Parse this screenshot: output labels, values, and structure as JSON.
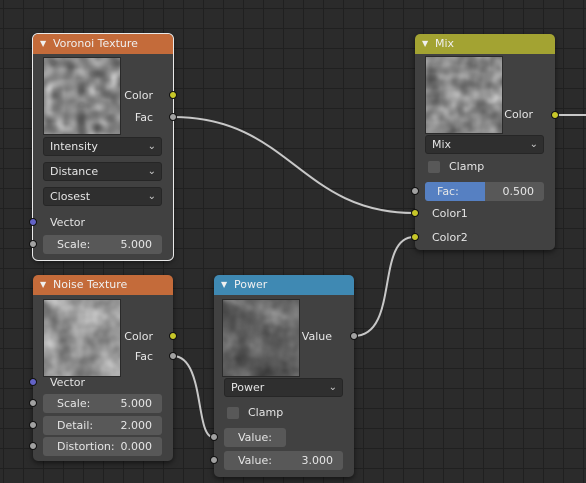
{
  "colors": {
    "texture_header": "#c46b3a",
    "converter_header": "#3f89b3",
    "color_header": "#a3a332",
    "socket_color": "#c7c729",
    "socket_value": "#a1a1a1",
    "socket_vector": "#6363c7",
    "slider_fill": "#5680c2",
    "link": "#c8c8c8"
  },
  "voronoi_node": {
    "title": "Voronoi Texture",
    "outputs": [
      "Color",
      "Fac"
    ],
    "coloring": "Intensity",
    "distance": "Distance",
    "feature": "Closest",
    "vector_label": "Vector",
    "scale_label": "Scale:",
    "scale_value": "5.000"
  },
  "noise_node": {
    "title": "Noise Texture",
    "outputs": [
      "Color",
      "Fac"
    ],
    "vector_label": "Vector",
    "scale_label": "Scale:",
    "scale_value": "5.000",
    "detail_label": "Detail:",
    "detail_value": "2.000",
    "distortion_label": "Distortion:",
    "distortion_value": "0.000"
  },
  "power_node": {
    "title": "Power",
    "output": "Value",
    "operation": "Power",
    "clamp_label": "Clamp",
    "value1_label": "Value:",
    "value2_label": "Value:",
    "value2_value": "3.000"
  },
  "mix_node": {
    "title": "Mix",
    "output": "Color",
    "blend_mode": "Mix",
    "clamp_label": "Clamp",
    "fac_label": "Fac:",
    "fac_value": "0.500",
    "fac_fraction": 0.5,
    "input1": "Color1",
    "input2": "Color2"
  }
}
